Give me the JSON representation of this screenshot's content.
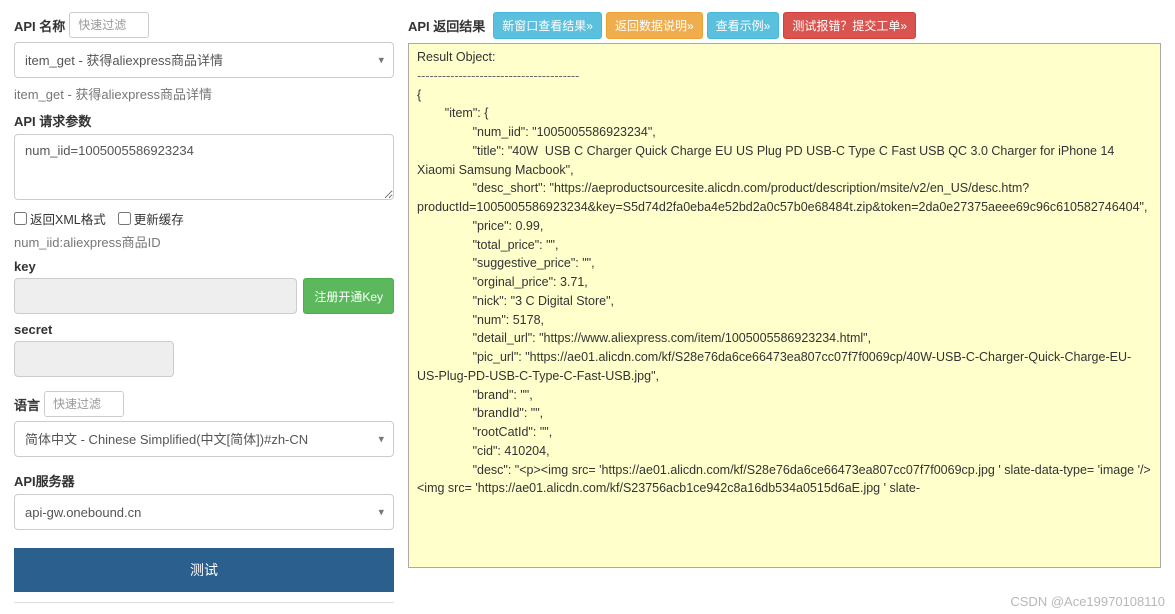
{
  "leftPanel": {
    "apiName": {
      "label": "API 名称",
      "filterPlaceholder": "快速过滤",
      "selectValue": "item_get - 获得aliexpress商品详情",
      "subText": "item_get - 获得aliexpress商品详情"
    },
    "reqParams": {
      "label": "API 请求参数",
      "value": "num_iid=1005005586923234",
      "xmlCheckbox": "返回XML格式",
      "cacheCheckbox": "更新缓存",
      "helper": "num_iid:aliexpress商品ID"
    },
    "key": {
      "label": "key",
      "value": "",
      "registerBtn": "注册开通Key"
    },
    "secret": {
      "label": "secret",
      "value": ""
    },
    "language": {
      "label": "语言",
      "filterPlaceholder": "快速过滤",
      "selectValue": "简体中文 - Chinese Simplified(中文[简体])#zh-CN"
    },
    "apiServer": {
      "label": "API服务器",
      "value": "api-gw.onebound.cn"
    },
    "testBtn": "测试"
  },
  "rightPanel": {
    "title": "API 返回结果",
    "buttons": {
      "newWindow": "新窗口查看结果»",
      "dataDesc": "返回数据说明»",
      "example": "查看示例»",
      "report": "测试报错？提交工单»"
    },
    "result": {
      "header": "Result Object:",
      "dashes": "---------------------------------------",
      "body": "{\n        \"item\": {\n                \"num_iid\": \"1005005586923234\",\n                \"title\": \"40W  USB C Charger Quick Charge EU US Plug PD USB-C Type C Fast USB QC 3.0 Charger for iPhone 14 Xiaomi Samsung Macbook\",\n                \"desc_short\": \"https://aeproductsourcesite.alicdn.com/product/description/msite/v2/en_US/desc.htm?productId=1005005586923234&key=S5d74d2fa0eba4e52bd2a0c57b0e68484t.zip&token=2da0e27375aeee69c96c610582746404\",\n                \"price\": 0.99,\n                \"total_price\": \"\",\n                \"suggestive_price\": \"\",\n                \"orginal_price\": 3.71,\n                \"nick\": \"3 C Digital Store\",\n                \"num\": 5178,\n                \"detail_url\": \"https://www.aliexpress.com/item/1005005586923234.html\",\n                \"pic_url\": \"https://ae01.alicdn.com/kf/S28e76da6ce66473ea807cc07f7f0069cp/40W-USB-C-Charger-Quick-Charge-EU-US-Plug-PD-USB-C-Type-C-Fast-USB.jpg\",\n                \"brand\": \"\",\n                \"brandId\": \"\",\n                \"rootCatId\": \"\",\n                \"cid\": 410204,\n                \"desc\": \"<p><img src= 'https://ae01.alicdn.com/kf/S28e76da6ce66473ea807cc07f7f0069cp.jpg ' slate-data-type= 'image '/><img src= 'https://ae01.alicdn.com/kf/S23756acb1ce942c8a16db534a0515d6aE.jpg ' slate-"
    }
  },
  "watermark": "CSDN @Ace19970108110"
}
